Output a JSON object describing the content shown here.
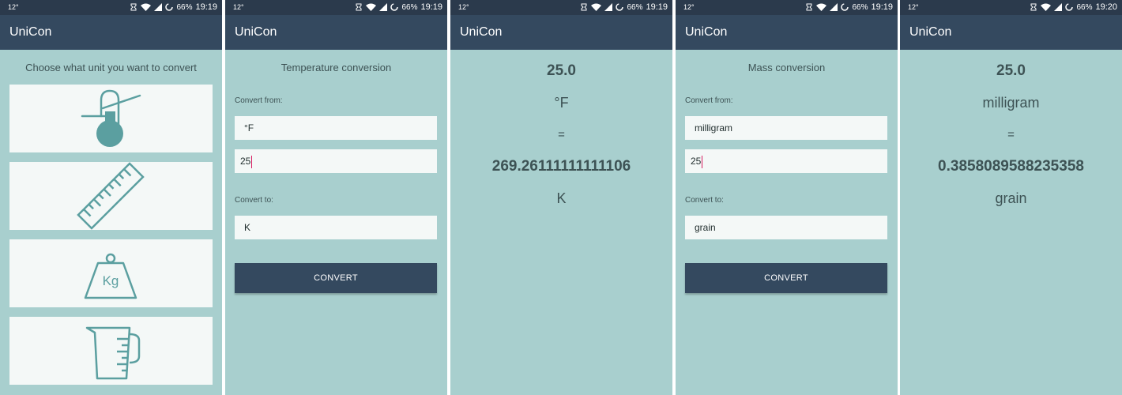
{
  "statusbar": {
    "temp": "12°",
    "battery": "66%",
    "times": [
      "19:19",
      "19:19",
      "19:19",
      "19:19",
      "19:20"
    ]
  },
  "app": {
    "title": "UniCon"
  },
  "home": {
    "heading": "Choose what unit you want to convert",
    "cards": [
      {
        "icon": "thermometer-icon"
      },
      {
        "icon": "ruler-icon"
      },
      {
        "icon": "weight-icon",
        "text": "Kg"
      },
      {
        "icon": "measuring-cup-icon"
      }
    ]
  },
  "temperature": {
    "title": "Temperature conversion",
    "from_label": "Convert from:",
    "from_unit": "°F",
    "value": "25",
    "to_label": "Convert to:",
    "to_unit": "K",
    "button": "CONVERT"
  },
  "temperature_result": {
    "input": "25.0",
    "from_unit": "°F",
    "equals": "=",
    "output": "269.26111111111106",
    "to_unit": "K"
  },
  "mass": {
    "title": "Mass conversion",
    "from_label": "Convert from:",
    "from_unit": "milligram",
    "value": "25",
    "to_label": "Convert to:",
    "to_unit": "grain",
    "button": "CONVERT"
  },
  "mass_result": {
    "input": "25.0",
    "from_unit": "milligram",
    "equals": "=",
    "output": "0.3858089588235358",
    "to_unit": "grain"
  },
  "colors": {
    "background": "#a8cfce",
    "statusbar": "#2b3a4c",
    "appbar": "#34495f",
    "icon": "#5b9fa0",
    "caret": "#d81b60"
  }
}
